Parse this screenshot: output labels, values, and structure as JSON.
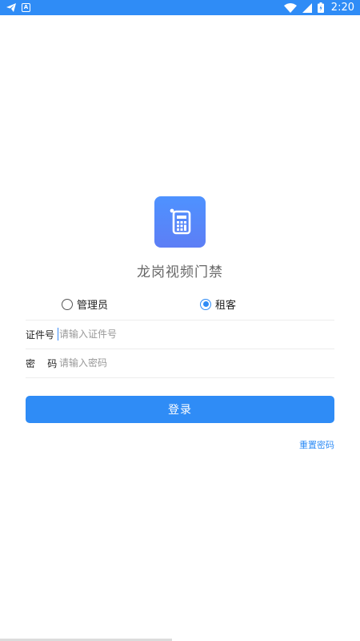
{
  "status_bar": {
    "time": "2:20",
    "icons": [
      "telegram-icon",
      "app-a-icon",
      "wifi-icon",
      "signal-icon",
      "battery-icon"
    ],
    "app_badge": "A"
  },
  "app": {
    "logo_icon": "calculator-icon",
    "title": "龙岗视频门禁"
  },
  "role_selector": {
    "options": [
      {
        "label": "管理员",
        "selected": false
      },
      {
        "label": "租客",
        "selected": true
      }
    ]
  },
  "form": {
    "id_label": "证件号",
    "id_placeholder": "请输入证件号",
    "password_label": "密    码",
    "password_placeholder": "请输入密码"
  },
  "actions": {
    "login_label": "登录",
    "reset_password_label": "重置密码"
  },
  "colors": {
    "accent": "#2f8cf6",
    "logo_gradient_top": "#4e92ff",
    "logo_gradient_bottom": "#5d7ef5",
    "title_gray": "#666666"
  }
}
